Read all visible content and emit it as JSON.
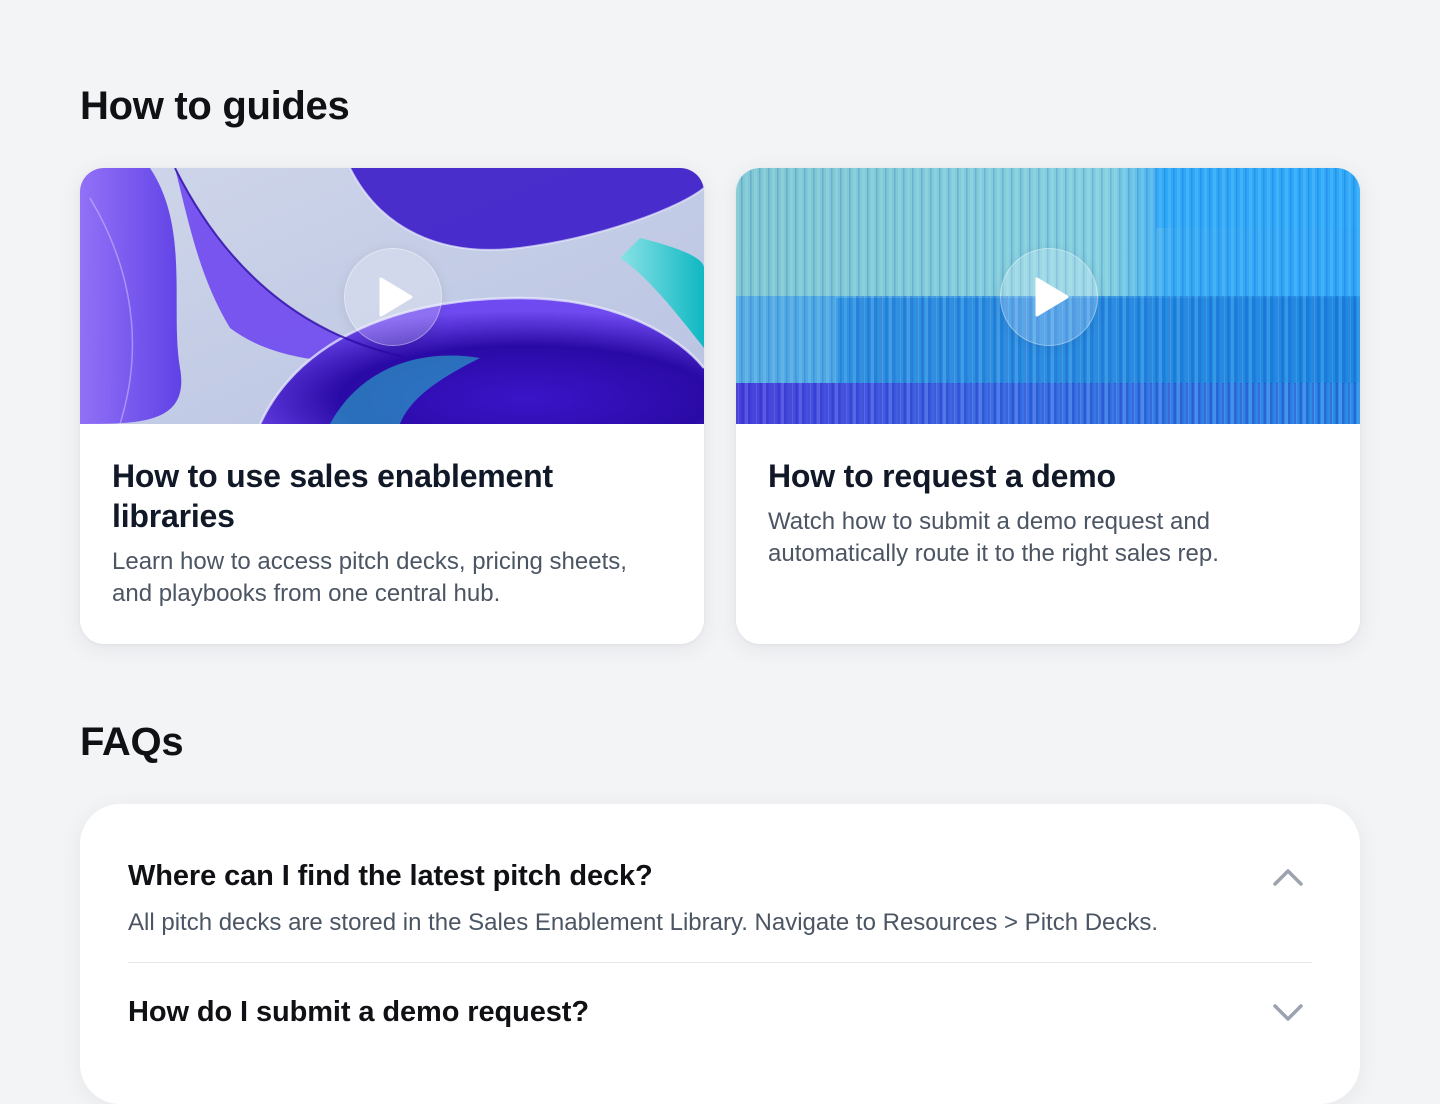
{
  "guides": {
    "title": "How to guides",
    "cards": [
      {
        "title": "How to use sales enablement libraries",
        "description": "Learn how to access pitch decks, pricing sheets, and playbooks from one central hub.",
        "thumbnail": "abstract-purple-glass",
        "icon": "play-icon"
      },
      {
        "title": "How to request a demo",
        "description": "Watch how to submit a demo request and automatically route it to the right sales rep.",
        "thumbnail": "blue-vertical-lines",
        "icon": "play-icon"
      }
    ]
  },
  "faq": {
    "title": "FAQs",
    "items": [
      {
        "question": "Where can I find the latest pitch deck?",
        "answer": "All pitch decks are stored in the Sales Enablement Library. Navigate to Resources > Pitch Decks.",
        "expanded": true,
        "icon": "chevron-up-icon"
      },
      {
        "question": "How do I submit a demo request?",
        "expanded": false,
        "icon": "chevron-down-icon"
      }
    ]
  },
  "colors": {
    "background": "#f3f4f6",
    "card": "#ffffff",
    "heading": "#0f1115",
    "body_text": "#4b5563",
    "chevron": "#9ca3af"
  }
}
